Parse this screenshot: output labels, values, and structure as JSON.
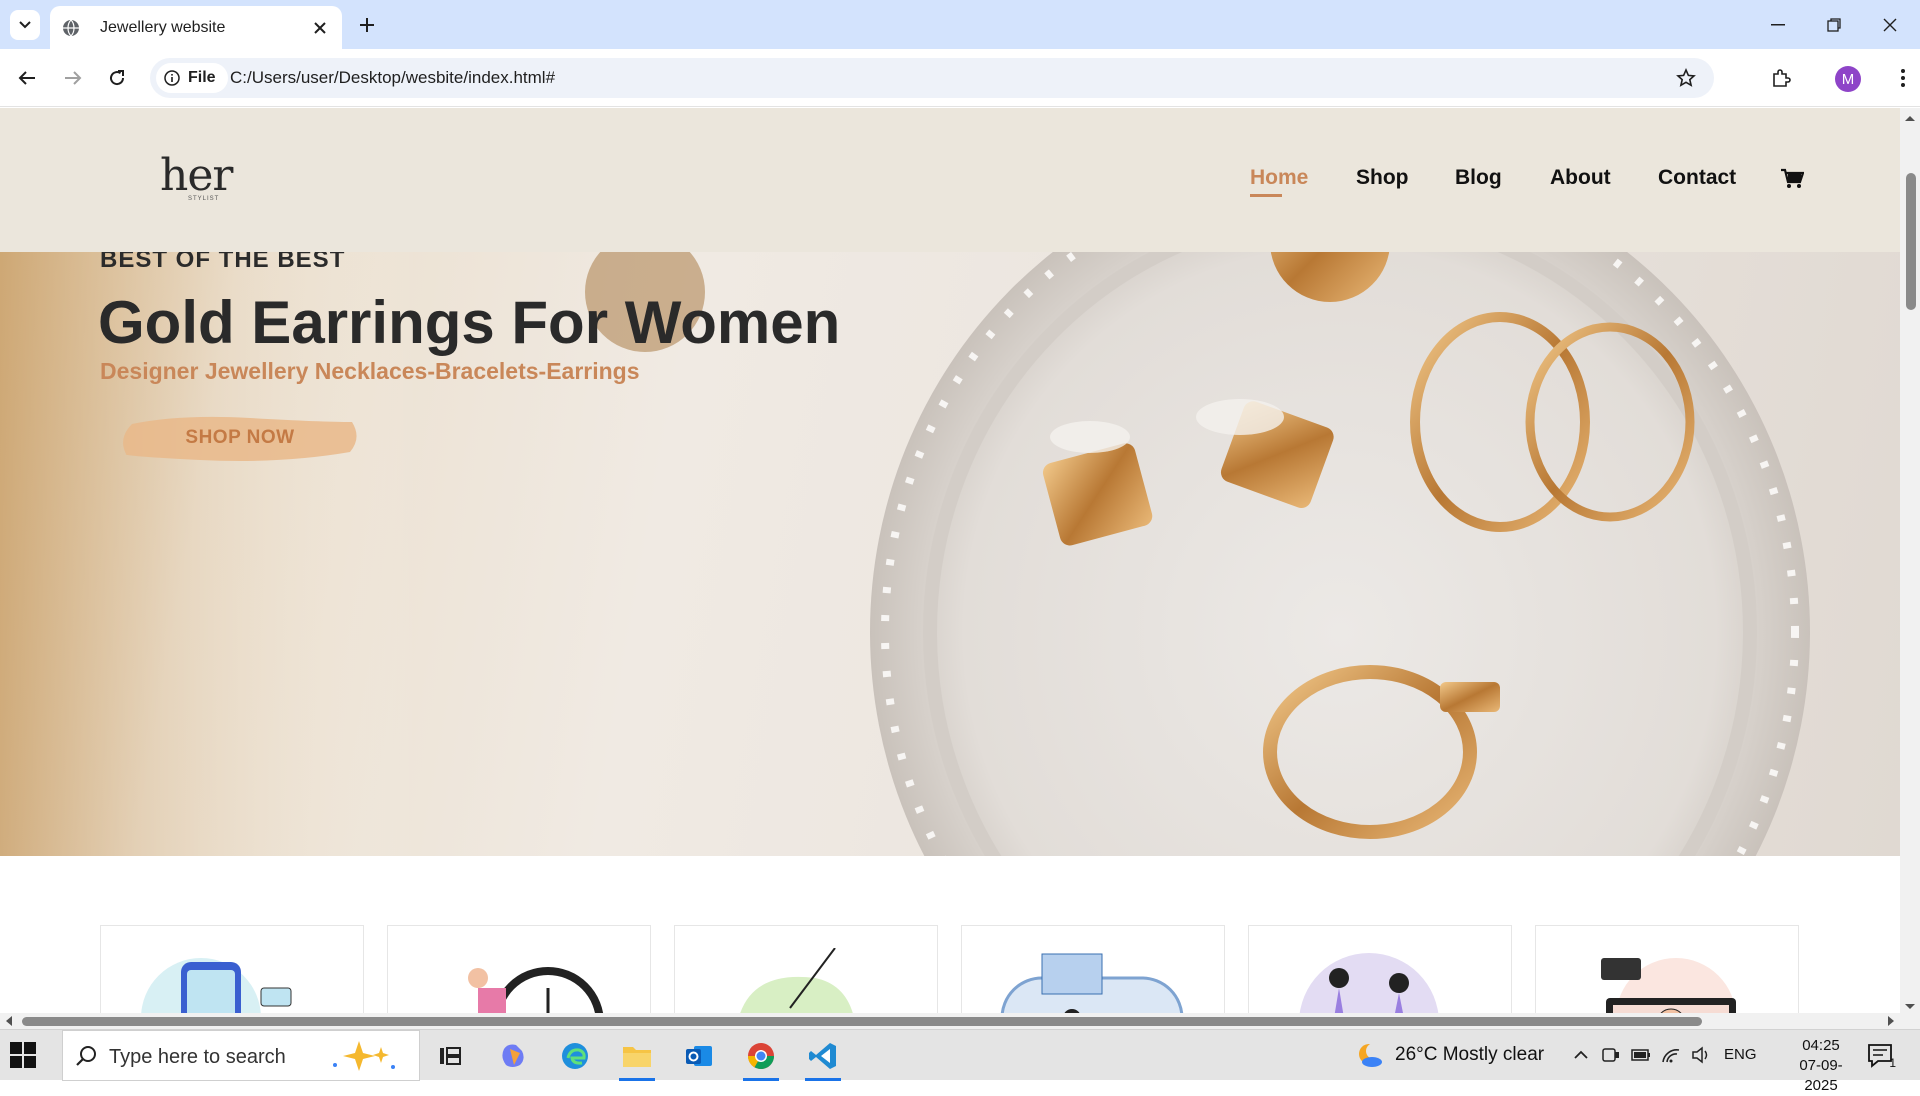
{
  "browser": {
    "tab_title": "Jewellery website",
    "site_chip_label": "File",
    "url": "C:/Users/user/Desktop/wesbite/index.html#",
    "profile_initial": "M"
  },
  "site": {
    "logo": "her",
    "logo_sub": "STYLIST",
    "nav": [
      {
        "label": "Home",
        "active": true
      },
      {
        "label": "Shop",
        "active": false
      },
      {
        "label": "Blog",
        "active": false
      },
      {
        "label": "About",
        "active": false
      },
      {
        "label": "Contact",
        "active": false
      }
    ],
    "accent_color": "#c98759"
  },
  "hero": {
    "eyebrow": "BEST OF THE BEST",
    "title": "Gold Earrings For Women",
    "subtitle": "Designer Jewellery Necklaces-Bracelets-Earrings",
    "cta": "SHOP NOW"
  },
  "features": {
    "icons": [
      "mobile-payment-illustration-icon",
      "fast-delivery-illustration-icon",
      "savings-piggy-bank-illustration-icon",
      "gift-offer-illustration-icon",
      "happy-customers-illustration-icon",
      "online-support-illustration-icon"
    ]
  },
  "taskbar": {
    "search_placeholder": "Type here to search",
    "weather": "26°C  Mostly clear",
    "language": "ENG",
    "time": "04:25",
    "date": "07-09-2025",
    "notification_count": "1"
  }
}
